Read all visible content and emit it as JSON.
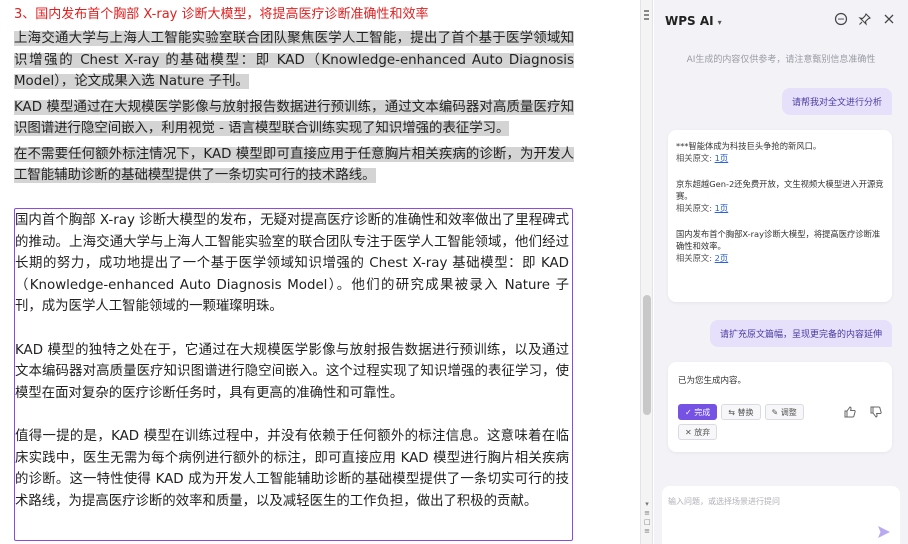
{
  "document": {
    "heading": "3、国内发布首个胸部 X-ray 诊断大模型，将提高医疗诊断准确性和效率",
    "highlighted_paragraphs": [
      "上海交通大学与上海人工智能实验室联合团队聚焦医学人工智能，提出了首个基于医学领域知识增强的 Chest X-ray 的基础模型：即 KAD（Knowledge-enhanced Auto Diagnosis Model），论文成果入选 Nature 子刊。",
      "KAD 模型通过在大规模医学影像与放射报告数据进行预训练，通过文本编码器对高质量医疗知识图谱进行隐空间嵌入，利用视觉 - 语言模型联合训练实现了知识增强的表征学习。",
      "在不需要任何额外标注情况下，KAD 模型即可直接应用于任意胸片相关疾病的诊断，为开发人工智能辅助诊断的基础模型提供了一条切实可行的技术路线。"
    ],
    "generated_paragraphs": [
      "国内首个胸部 X-ray 诊断大模型的发布，无疑对提高医疗诊断的准确性和效率做出了里程碑式的推动。上海交通大学与上海人工智能实验室的联合团队专注于医学人工智能领域，他们经过长期的努力，成功地提出了一个基于医学领域知识增强的 Chest X-ray 基础模型：即 KAD（Knowledge-enhanced Auto Diagnosis Model）。他们的研究成果被录入 Nature 子刊，成为医学人工智能领域的一颗璀璨明珠。",
      "KAD 模型的独特之处在于，它通过在大规模医学影像与放射报告数据进行预训练，以及通过文本编码器对高质量医疗知识图谱进行隐空间嵌入。这个过程实现了知识增强的表征学习，使模型在面对复杂的医疗诊断任务时，具有更高的准确性和可靠性。",
      "值得一提的是，KAD 模型在训练过程中，并没有依赖于任何额外的标注信息。这意味着在临床实践中，医生无需为每个病例进行额外的标注，即可直接应用 KAD 模型进行胸片相关疾病的诊断。这一特性使得 KAD 成为开发人工智能辅助诊断的基础模型提供了一条切实可行的技术路线，为提高医疗诊断的效率和质量，以及减轻医生的工作负担，做出了积极的贡献。"
    ]
  },
  "panel": {
    "title": "WPS AI",
    "disclaimer": "AI生成的内容仅供参考，请注意甄别信息准确性",
    "user_message_1": "请帮我对全文进行分析",
    "analysis_entries": [
      {
        "text": "***智能体成为科技巨头争抢的新风口。",
        "ref_label": "相关原文: ",
        "ref_link": "1页"
      },
      {
        "text": "京东超越Gen-2还免费开放，文生视频大模型进入开源竞赛。",
        "ref_label": "相关原文: ",
        "ref_link": "1页"
      },
      {
        "text": "国内发布首个胸部X-ray诊断大模型，将提高医疗诊断准确性和效率。",
        "ref_label": "相关原文: ",
        "ref_link": "2页"
      }
    ],
    "user_message_2": "请扩充原文篇幅，呈现更完备的内容延伸",
    "result_text": "已为您生成内容。",
    "actions": {
      "done": "✓ 完成",
      "replace": "⇆ 替换",
      "adjust": "✎ 调整",
      "discard": "✕ 放弃"
    },
    "input_placeholder": "输入问题，或选择场景进行提问"
  },
  "colors": {
    "accent": "#7552e3",
    "heading_red": "#e02020",
    "highlight_gray": "#d4d4d4",
    "generated_border": "#8a4ddb",
    "link_blue": "#2c61d8"
  }
}
